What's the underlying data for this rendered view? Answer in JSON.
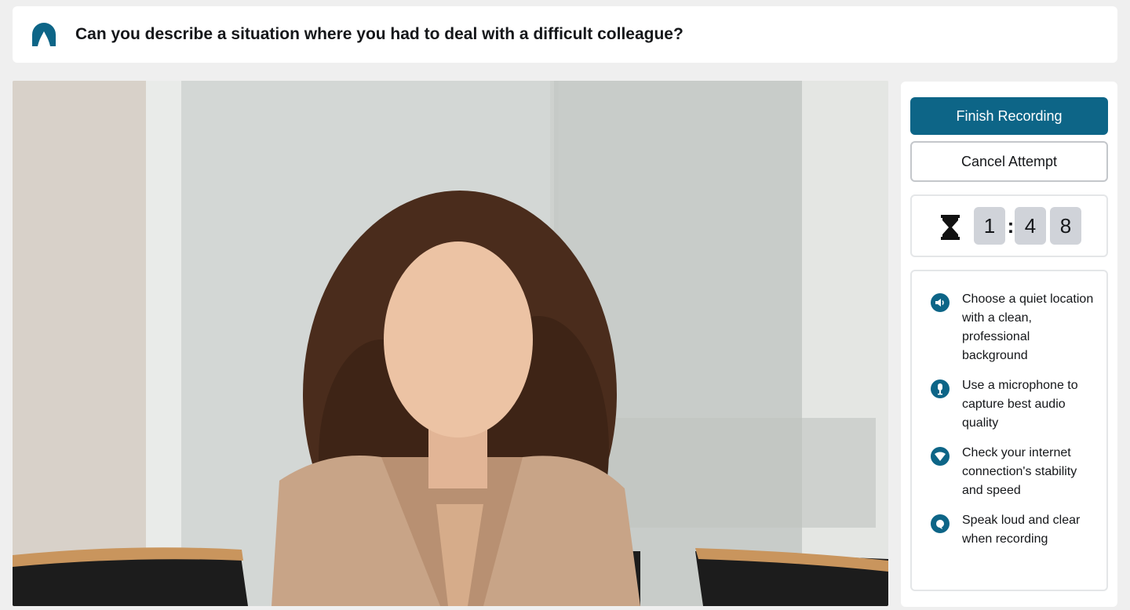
{
  "question": {
    "text": "Can you describe a situation where you had to deal with a difficult colleague?",
    "logo_icon": "brand-logo-icon"
  },
  "video": {
    "description_icon": "video-feed"
  },
  "controls": {
    "finish_label": "Finish Recording",
    "cancel_label": "Cancel Attempt"
  },
  "timer": {
    "icon": "hourglass-icon",
    "minutes": "1",
    "separator": ":",
    "seconds_tens": "4",
    "seconds_ones": "8"
  },
  "tips": [
    {
      "icon": "speaker-icon",
      "text": "Choose a quiet location with a clean, professional background"
    },
    {
      "icon": "microphone-icon",
      "text": "Use a microphone to capture best audio quality"
    },
    {
      "icon": "wifi-icon",
      "text": "Check your internet connection's stability and speed"
    },
    {
      "icon": "speech-bubble-icon",
      "text": "Speak loud and clear when recording"
    }
  ],
  "colors": {
    "accent": "#0d6587",
    "background": "#efefef",
    "timer_digit_bg": "#d0d3d9"
  }
}
